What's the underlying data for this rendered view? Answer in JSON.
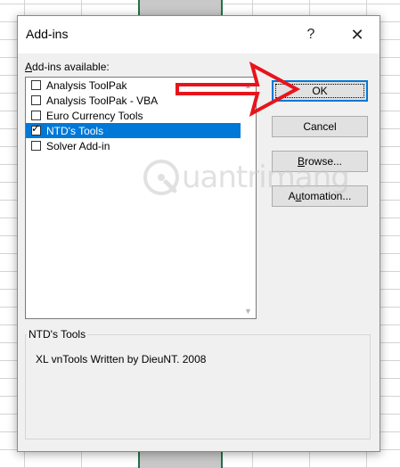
{
  "dialog": {
    "title": "Add-ins",
    "help_glyph": "?",
    "close_glyph": "✕"
  },
  "list": {
    "label_prefix": "",
    "label_accel": "A",
    "label_rest": "dd-ins available:",
    "items": [
      {
        "label": "Analysis ToolPak",
        "checked": false,
        "selected": false
      },
      {
        "label": "Analysis ToolPak - VBA",
        "checked": false,
        "selected": false
      },
      {
        "label": "Euro Currency Tools",
        "checked": false,
        "selected": false
      },
      {
        "label": "NTD's Tools",
        "checked": true,
        "selected": true
      },
      {
        "label": "Solver Add-in",
        "checked": false,
        "selected": false
      }
    ]
  },
  "buttons": {
    "ok": "OK",
    "cancel": "Cancel",
    "browse_accel": "B",
    "browse_rest": "rowse...",
    "automation_pre": "A",
    "automation_accel": "u",
    "automation_rest": "tomation..."
  },
  "details": {
    "title": "NTD's Tools",
    "description": "XL vnTools Written by DieuNT. 2008"
  },
  "watermark": {
    "text": "uantrimang"
  },
  "colors": {
    "selection": "#0078d7",
    "arrow": "#e8141b",
    "excel_green": "#217346"
  }
}
